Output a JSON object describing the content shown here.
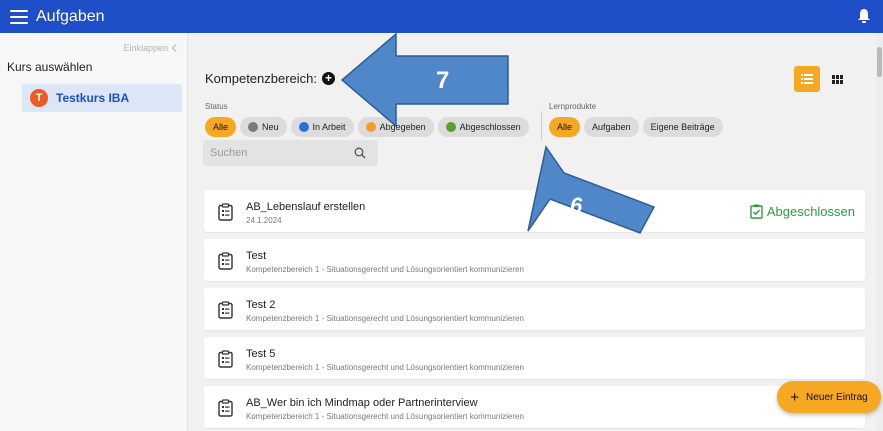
{
  "appbar": {
    "title": "Aufgaben",
    "menu_icon": "hamburger-menu-icon",
    "bell_icon": "bell-icon"
  },
  "sidebar": {
    "collapse_label": "Einklappen",
    "heading": "Kurs auswählen",
    "course": {
      "initial": "T",
      "name": "Testkurs IBA"
    }
  },
  "main": {
    "kompetenz_label": "Kompetenzbereich:",
    "status_label": "Status",
    "status_filters": [
      {
        "label": "Alle",
        "active": true
      },
      {
        "label": "Neu",
        "color": "#7a7a7a"
      },
      {
        "label": "In Arbeit",
        "color": "#2d6de0"
      },
      {
        "label": "Abgegeben",
        "color": "#f39c2b"
      },
      {
        "label": "Abgeschlossen",
        "color": "#5a9e2f"
      }
    ],
    "lernprodukte_label": "Lernprodukte",
    "lernprodukte_filters": [
      {
        "label": "Alle",
        "active": true
      },
      {
        "label": "Aufgaben"
      },
      {
        "label": "Eigene Beiträge"
      }
    ],
    "search": {
      "placeholder": "Suchen",
      "value": ""
    },
    "items": [
      {
        "title": "AB_Lebenslauf erstellen",
        "subtitle": "24.1.2024",
        "status": "Abgeschlossen"
      },
      {
        "title": "Test",
        "subtitle": "Kompetenzbereich 1 - Situationsgerecht und Lösungsorientiert kommunizieren"
      },
      {
        "title": "Test 2",
        "subtitle": "Kompetenzbereich 1 - Situationsgerecht und Lösungsorientiert kommunizieren"
      },
      {
        "title": "Test 5",
        "subtitle": "Kompetenzbereich 1 - Situationsgerecht und Lösungsorientiert kommunizieren"
      },
      {
        "title": "AB_Wer bin ich Mindmap oder Partnerinterview",
        "subtitle": "Kompetenzbereich 1 - Situationsgerecht und Lösungsorientiert kommunizieren"
      }
    ],
    "new_entry_label": "Neuer Eintrag"
  },
  "annotations": {
    "arrow_1_label": "7",
    "arrow_2_label": "6"
  },
  "colors": {
    "primary": "#1f4fc8",
    "accent": "#f7a823",
    "success": "#2e9c3f",
    "arrow_fill": "#4f87c9"
  }
}
